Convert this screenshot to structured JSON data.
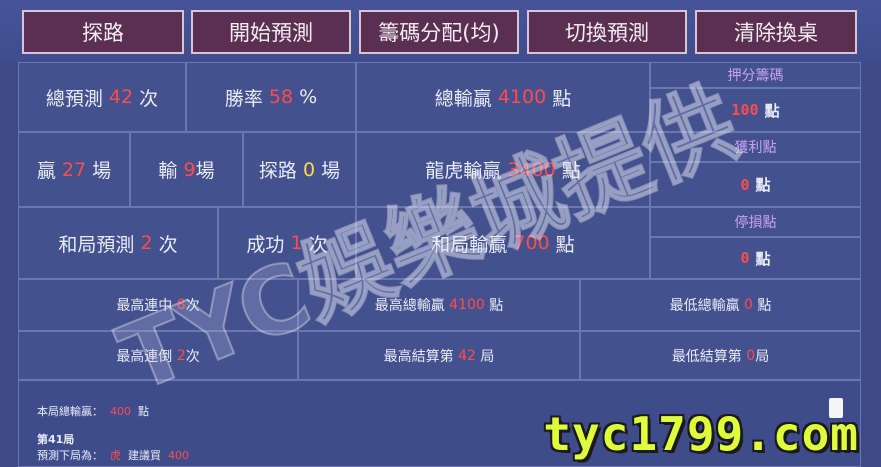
{
  "toolbar": {
    "route": "探路",
    "start": "開始預測",
    "chips": "籌碼分配(均)",
    "switch": "切換預測",
    "clear": "清除換桌"
  },
  "stats": {
    "total_pred_label": "總預測",
    "total_pred": "42",
    "total_pred_unit": "次",
    "winrate_label": "勝率",
    "winrate": "58",
    "winrate_unit": "%",
    "total_win_label": "總輸贏",
    "total_win": "4100",
    "total_win_unit": "點",
    "win_label": "贏",
    "win": "27",
    "win_unit": "場",
    "lose_label": "輸",
    "lose": "9",
    "lose_unit": "場",
    "route_label": "探路",
    "route": "0",
    "route_unit": "場",
    "dragon_label": "龍虎輸贏",
    "dragon": "3400",
    "dragon_unit": "點",
    "tie_pred_label": "和局預測",
    "tie_pred": "2",
    "tie_pred_unit": "次",
    "success_label": "成功",
    "success": "1",
    "success_unit": "次",
    "tie_win_label": "和局輸贏",
    "tie_win": "700",
    "tie_win_unit": "點"
  },
  "side": {
    "bet_label": "押分籌碼",
    "bet_value": "100",
    "bet_unit": "點",
    "profit_label": "獲利點",
    "profit_value": "0",
    "profit_unit": "點",
    "stop_label": "停損點",
    "stop_value": "0",
    "stop_unit": "點"
  },
  "records": {
    "max_streak_label": "最高連中",
    "max_streak": "8",
    "max_streak_unit": "次",
    "max_total_label": "最高總輸贏",
    "max_total": "4100",
    "max_total_unit": "點",
    "min_total_label": "最低總輸贏",
    "min_total": "0",
    "min_total_unit": "點",
    "max_lose_label": "最高連倒",
    "max_lose": "2",
    "max_lose_unit": "次",
    "max_settle_label": "最高結算第",
    "max_settle": "42",
    "max_settle_unit": "局",
    "min_settle_label": "最低結算第",
    "min_settle": "0",
    "min_settle_unit": "局"
  },
  "bottom": {
    "round_total_label": "本局總輸贏：",
    "round_total": "400",
    "round_total_unit": "點",
    "round_no": "第41局",
    "next_label": "預測下局為：",
    "next_pick": "虎",
    "suggest_label": "建議買",
    "suggest_value": "400"
  },
  "watermark": {
    "text": "TYC娛樂城提供"
  },
  "logo": {
    "text": "tyc1799.com"
  },
  "colors": {
    "accent_red": "#ff4b4b",
    "accent_yellow": "#ffd94a",
    "button_bg": "#5b2f52"
  }
}
